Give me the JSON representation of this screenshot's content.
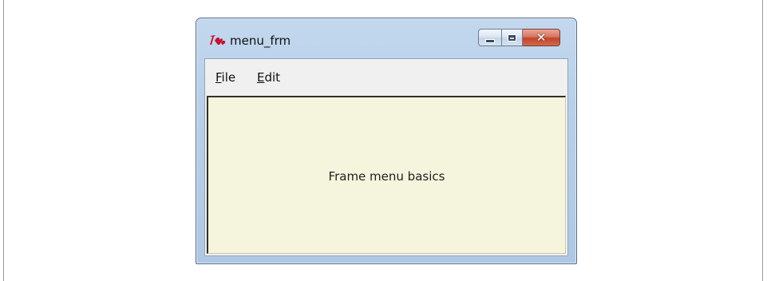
{
  "window": {
    "title": "menu_frm",
    "icon": "tk-feather-icon",
    "caption_buttons": {
      "minimize": "minimize-icon",
      "maximize": "maximize-icon",
      "close": "close-icon"
    }
  },
  "menubar": {
    "items": [
      {
        "mnemonic": "F",
        "rest": "ile"
      },
      {
        "mnemonic": "E",
        "rest": "dit"
      }
    ]
  },
  "content": {
    "label": "Frame menu basics",
    "background": "#f5f4dc"
  },
  "colors": {
    "close_button": "#c7452a",
    "titlebar": "#b9d1ea"
  }
}
